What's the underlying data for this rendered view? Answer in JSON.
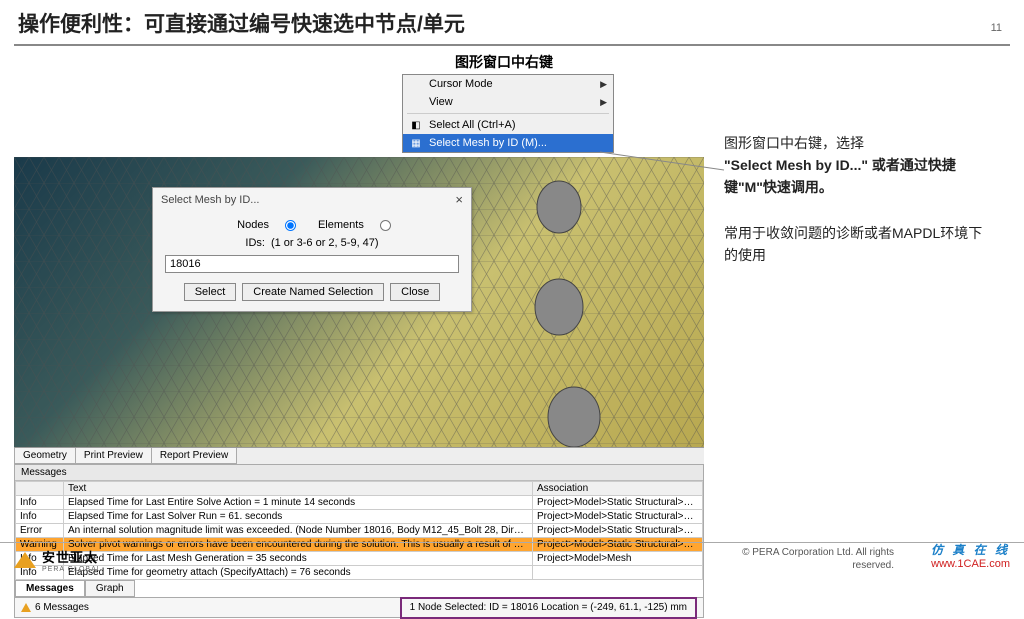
{
  "page": {
    "title": "操作便利性：可直接通过编号快速选中节点/单元",
    "number": "11"
  },
  "contextMenuLabel": "图形窗口中右键",
  "contextMenu": {
    "items": [
      {
        "label": "Cursor Mode",
        "arrow": true
      },
      {
        "label": "View",
        "arrow": true
      }
    ],
    "selectAll": "Select All (Ctrl+A)",
    "selectMesh": "Select Mesh by ID (M)..."
  },
  "dialog": {
    "title": "Select Mesh by ID...",
    "nodesLabel": "Nodes",
    "elementsLabel": "Elements",
    "idsLabel": "IDs:",
    "idsHint": "(1 or 3-6 or 2, 5-9, 47)",
    "value": "18016",
    "btnSelect": "Select",
    "btnCreate": "Create Named Selection",
    "btnClose": "Close"
  },
  "viewTabs": [
    "Geometry",
    "Print Preview",
    "Report Preview"
  ],
  "messages": {
    "panelTitle": "Messages",
    "headers": {
      "type": "",
      "text": "Text",
      "assoc": "Association"
    },
    "rows": [
      {
        "type": "Info",
        "text": "Elapsed Time for Last Entire Solve Action = 1 minute 14 seconds",
        "assoc": "Project>Model>Static Structural>Solutio"
      },
      {
        "type": "Info",
        "text": "Elapsed Time for Last Solver Run = 61. seconds",
        "assoc": "Project>Model>Static Structural>Solutio"
      },
      {
        "type": "Error",
        "text": "An internal solution magnitude limit was exceeded. (Node Number 18016, Body M12_45_Bolt 28, Direction UY) Please check you",
        "assoc": "Project>Model>Static Structural>Solutio"
      },
      {
        "type": "Warning",
        "text": "Solver pivot warnings or errors have been encountered during the solution.  This is usually a result of an ill conditioned matrix pc",
        "assoc": "Project>Model>Static Structural>Solutio",
        "warn": true
      },
      {
        "type": "Info",
        "text": "Elapsed Time for Last Mesh Generation = 35 seconds",
        "assoc": "Project>Model>Mesh"
      },
      {
        "type": "Info",
        "text": "Elapsed Time for geometry attach (SpecifyAttach) = 76  seconds",
        "assoc": ""
      }
    ]
  },
  "bottomTabs": {
    "messages": "Messages",
    "graph": "Graph"
  },
  "status": {
    "messagesCount": "6 Messages",
    "selection": "1 Node Selected: ID = 18016  Location = (-249, 61.1, -125) mm"
  },
  "notes": {
    "line1a": "图形窗口中右键，选择",
    "line1b": "\"Select Mesh by ID...\"",
    "line1c": "或者通过快捷键\"M\"快速调用。",
    "line2": "常用于收敛问题的诊断或者MAPDL环境下的使用"
  },
  "footer": {
    "logoMain": "安世亚太",
    "logoSub": "PERA GLOBAL",
    "copy1": "©   PERA Corporation Ltd. All rights",
    "copy2": "reserved.",
    "brandCn": "仿 真 在 线",
    "brandUrl": "www.1CAE.com"
  }
}
